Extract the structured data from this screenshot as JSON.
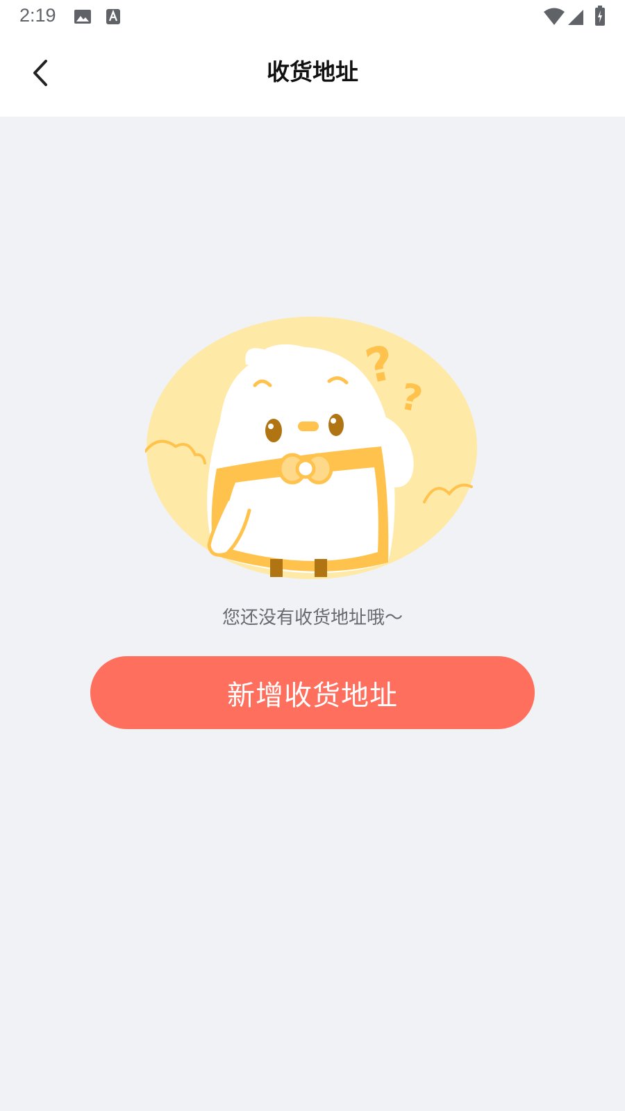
{
  "status_bar": {
    "time": "2:19",
    "left_icons": [
      "image-icon",
      "text-a-icon"
    ],
    "right_icons": [
      "wifi-icon",
      "signal-icon",
      "battery-charging-icon"
    ]
  },
  "header": {
    "back_icon": "chevron-left-icon",
    "title": "收货地址"
  },
  "empty_state": {
    "illustration": "confused-mascot-with-question-marks",
    "message": "您还没有收货地址哦～"
  },
  "actions": {
    "add_address_label": "新增收货地址"
  },
  "colors": {
    "background": "#f0f2f5",
    "header": "#ffffff",
    "accent_button": "#ff6f5e",
    "illustration_bg": "#ffe9a6",
    "illustration_accent": "#ffc24d"
  }
}
